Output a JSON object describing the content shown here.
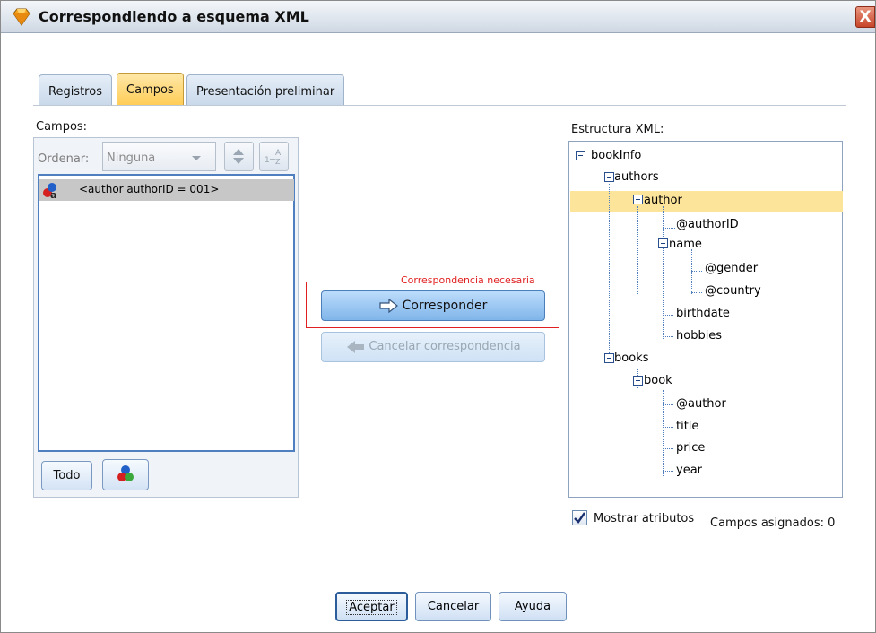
{
  "window": {
    "title": "Correspondiendo a esquema XML",
    "close_glyph": "X"
  },
  "tabs": [
    {
      "label": "Registros",
      "active": false
    },
    {
      "label": "Campos",
      "active": true
    },
    {
      "label": "Presentación preliminar",
      "active": false
    }
  ],
  "fields_panel": {
    "label": "Campos:",
    "sort_label": "Ordenar:",
    "sort_value": "Ninguna",
    "items": [
      {
        "label": "<author authorID = 001>",
        "icon": "set-field-icon"
      }
    ],
    "all_button": "Todo",
    "filter_icon": "field-type-filter-icon"
  },
  "mapping": {
    "required_label": "Correspondencia necesaria",
    "map_button": "Corresponder",
    "unmap_button": "Cancelar correspondencia"
  },
  "xml_tree": {
    "label": "Estructura XML:",
    "selected": "author",
    "nodes": [
      "bookInfo",
      "authors",
      "author",
      "@authorID",
      "name",
      "@gender",
      "@country",
      "birthdate",
      "hobbies",
      "books",
      "book",
      "@author",
      "title",
      "price",
      "year"
    ]
  },
  "options": {
    "show_attributes_label": "Mostrar atributos",
    "show_attributes_checked": true,
    "assigned_fields_label": "Campos asignados: 0"
  },
  "footer": {
    "ok": "Aceptar",
    "cancel": "Cancelar",
    "help": "Ayuda"
  },
  "colors": {
    "tab_active": "#ffcc55",
    "selection": "#fde49b",
    "required_red": "#e02020"
  }
}
